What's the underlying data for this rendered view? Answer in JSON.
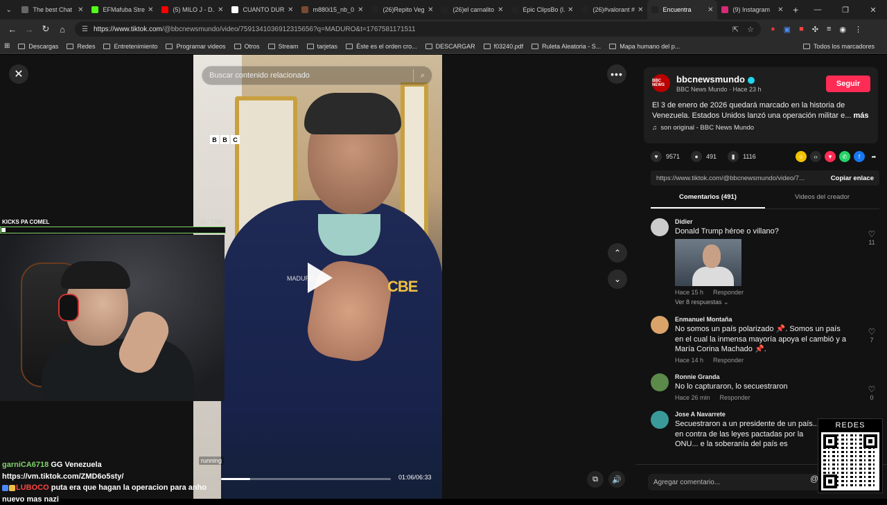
{
  "browser": {
    "tabs": [
      {
        "label": "The best Chat",
        "color": "#666"
      },
      {
        "label": "EFMafuba Strea",
        "color": "#53fc18"
      },
      {
        "label": "(5) MILO J - D...",
        "color": "#f00"
      },
      {
        "label": "CUANTO DUR...",
        "color": "#fff"
      },
      {
        "label": "m880i15_nb_0...",
        "color": "#7a4a30"
      },
      {
        "label": "(26)Repito Veg...",
        "color": "#222"
      },
      {
        "label": "(26)el carnalito",
        "color": "#222"
      },
      {
        "label": "Epic ClipsBo (l...",
        "color": "#222"
      },
      {
        "label": "(26)#valorant #...",
        "color": "#222"
      },
      {
        "label": "Encuentra",
        "color": "#222"
      },
      {
        "label": "(9) Instagram",
        "color": "#d62976"
      }
    ],
    "url_domain": "https://www.tiktok.com",
    "url_rest": "/@bbcnewsmundo/video/7591341036912315656?q=MADURO&t=1767581171511",
    "bookmarks": [
      "Descargas",
      "Redes",
      "Entretenimiento",
      "Programar videos",
      "Otros",
      "Stream",
      "tarjetas",
      "Éste es el orden cro...",
      "DESCARGAR",
      "f03240.pdf",
      "Ruleta Aleatoria - S...",
      "Mapa humano del p..."
    ],
    "bookmarks_right": "Todos los marcadores"
  },
  "video": {
    "search_placeholder": "Buscar contenido relacionado",
    "time": "01:06/06:33",
    "progress": 0.17,
    "running_label": "running",
    "jacket_text": "MADURO",
    "logo_text": "CBE"
  },
  "stream": {
    "cam_label": "KICKS PA COMEL",
    "counter": "29 / 1000",
    "chat": [
      {
        "user": "garniCA6718",
        "text": "GG Venezuela https://vm.tiktok.com/ZMD6o5sty/"
      },
      {
        "user": "LUBOCO",
        "text": "puta era que hagan la operacion para anho nuevo mas nazi"
      }
    ],
    "qr_title": "REDES"
  },
  "post": {
    "author": "bbcnewsmundo",
    "author_sub": "BBC News Mundo · Hace 23 h",
    "avatar_text": "BBC NEWS",
    "follow": "Seguir",
    "description": "El 3 de enero de 2026 quedará marcado en la historia de Venezuela. Estados Unidos lanzó una operación militar e...",
    "more": "más",
    "sound": "son original - BBC News Mundo",
    "likes": "9571",
    "comments_count": "491",
    "saves": "1116",
    "link": "https://www.tiktok.com/@bbcnewsmundo/video/7...",
    "copy": "Copiar enlace",
    "tab_comments": "Comentarios (491)",
    "tab_creator": "Videos del creador",
    "add_comment": "Agregar comentario..."
  },
  "comments": [
    {
      "name": "Didier",
      "text": "Donald Trump héroe o villano?",
      "time": "Hace 15 h",
      "reply": "Responder",
      "likes": "11",
      "replies": "Ver 8 respuestas",
      "color": "#ccc"
    },
    {
      "name": "Enmanuel Montaña",
      "text": "No somos un país polarizado 📌. Somos un país en el cual la inmensa mayoría apoya el cambió y a María Corina Machado 📌.",
      "time": "Hace 14 h",
      "reply": "Responder",
      "likes": "7",
      "color": "#d9a36a"
    },
    {
      "name": "Ronnie Granda",
      "text": "No lo capturaron, lo secuestraron",
      "time": "Hace 26 min",
      "reply": "Responder",
      "likes": "0",
      "color": "#5c8a4a"
    },
    {
      "name": "Jose A Navarrete",
      "text": "Secuestraron a un presidente de un país... en contra de las leyes pactadas por la ONU... e la soberanía del país es completamente pr...",
      "color": "#3a9a9a"
    }
  ]
}
